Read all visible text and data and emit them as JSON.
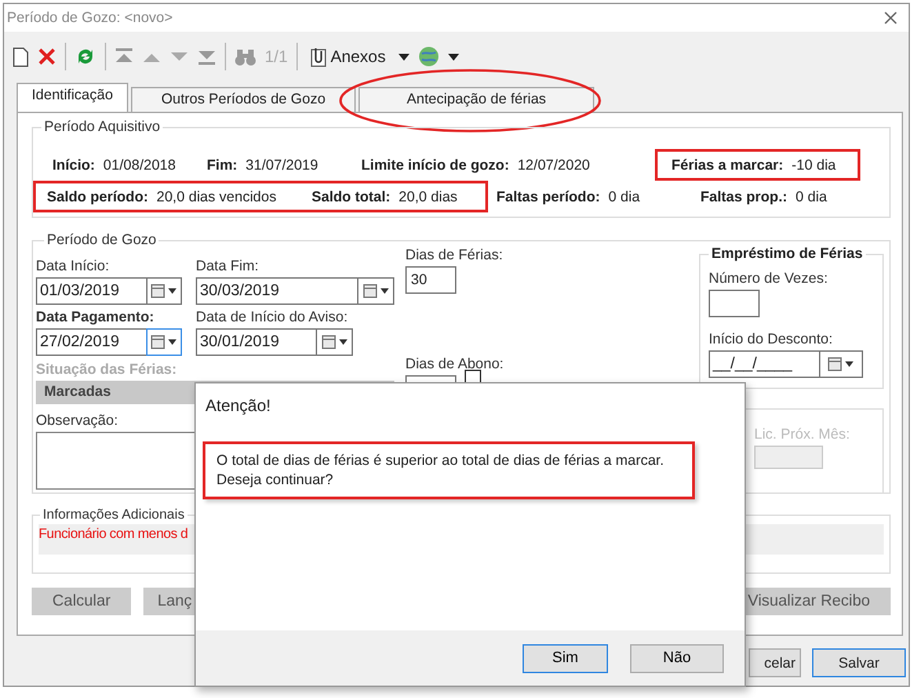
{
  "window": {
    "title": "Período de Gozo: <novo>"
  },
  "toolbar": {
    "record_counter": "1/1",
    "attachments_label": "Anexos"
  },
  "tabs": [
    {
      "label": "Identificação",
      "selected": true,
      "circled": false
    },
    {
      "label": "Outros Períodos de Gozo",
      "selected": false,
      "circled": false
    },
    {
      "label": "Antecipação de férias",
      "selected": false,
      "circled": true
    }
  ],
  "periodo_aquisitivo": {
    "title": "Período Aquisitivo",
    "rows": [
      [
        {
          "highlighted": false,
          "items": [
            {
              "label": "Início:",
              "value": "01/08/2018"
            },
            {
              "label": "Fim:",
              "value": "31/07/2019"
            },
            {
              "label": "Limite início de gozo:",
              "value": "12/07/2020"
            }
          ]
        },
        {
          "highlighted": true,
          "items": [
            {
              "label": "Férias a marcar:",
              "value": "-10 dia"
            }
          ]
        }
      ],
      [
        {
          "highlighted": true,
          "items": [
            {
              "label": "Saldo período:",
              "value": "20,0 dias vencidos"
            },
            {
              "label": "Saldo total:",
              "value": "20,0 dias"
            }
          ]
        },
        {
          "highlighted": false,
          "items": [
            {
              "label": "Faltas período:",
              "value": "0 dia"
            },
            {
              "label": "Faltas prop.:",
              "value": "0 dia"
            }
          ]
        }
      ]
    ]
  },
  "periodo_gozo": {
    "title": "Período de Gozo",
    "data_inicio": {
      "label": "Data Início:",
      "value": "01/03/2019",
      "required": false,
      "focused": false
    },
    "data_fim": {
      "label": "Data Fim:",
      "value": "30/03/2019",
      "required": false,
      "focused": false
    },
    "dias_ferias": {
      "label": "Dias de Férias:",
      "value": "30"
    },
    "data_pagamento": {
      "label": "Data Pagamento:",
      "value": "27/02/2019",
      "required": true,
      "focused": true
    },
    "data_aviso": {
      "label": "Data de Início do Aviso:",
      "value": "30/01/2019",
      "required": false,
      "focused": false
    },
    "situacao": {
      "label": "Situação das Férias:",
      "value": "Marcadas",
      "disabled": true
    },
    "dias_abono": {
      "label": "Dias de Abono:",
      "checked": false
    },
    "observacao": {
      "label": "Observação:"
    },
    "emprestimo": {
      "title": "Empréstimo de Férias",
      "numero_vezes": {
        "label": "Número de Vezes:"
      },
      "inicio_desconto": {
        "label": "Início do Desconto:",
        "value": "__/__/____"
      }
    },
    "licenca": {
      "label": "Lic. Próx. Mês:",
      "disabled": true
    }
  },
  "informacoes": {
    "title": "Informações Adicionais",
    "message": "Funcionário com menos d"
  },
  "actions": {
    "left": [
      "Calcular",
      "Lanç"
    ],
    "right": [
      "Visualizar Recibo"
    ]
  },
  "footer_buttons": [
    {
      "label": "celar",
      "default": false
    },
    {
      "label": "Salvar",
      "default": true
    }
  ],
  "dialog": {
    "title": "Atenção!",
    "message": "O total de dias de férias é superior ao total de dias de férias a marcar.\nDeseja continuar?",
    "highlighted": true,
    "buttons": [
      {
        "label": "Sim",
        "default": true
      },
      {
        "label": "Não",
        "default": false
      }
    ]
  }
}
